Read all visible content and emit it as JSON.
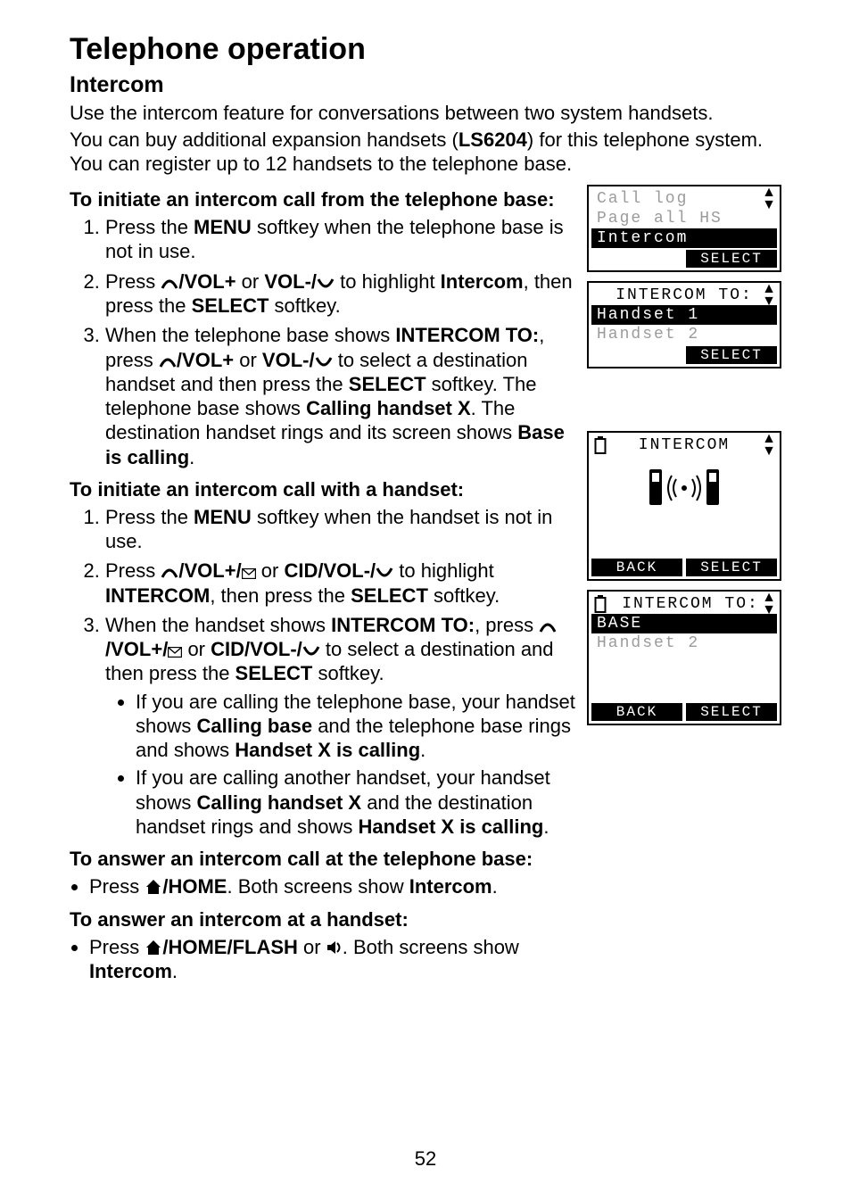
{
  "headings": {
    "h1": "Telephone operation",
    "h2": "Intercom"
  },
  "intro": {
    "p1": "Use the intercom feature for conversations between two system handsets.",
    "p2a": "You can buy additional expansion handsets (",
    "p2_model": "LS6204",
    "p2b": ") for this telephone system. You can register up to 12 handsets to the telephone base."
  },
  "subheadings": {
    "from_base": "To initiate an intercom call from the telephone base:",
    "with_handset": "To initiate an intercom call with a handset:",
    "answer_base": "To answer an intercom call at the telephone base:",
    "answer_handset": "To answer an intercom at a handset:"
  },
  "from_base_steps": {
    "s1a": "Press the ",
    "s1_menu": "MENU",
    "s1b": " softkey when the telephone base is not in use.",
    "s2a": "Press ",
    "s2_vol1a": "/",
    "s2_vol1b": "VOL+",
    "s2_or": " or ",
    "s2_vol2a": "VOL-/",
    "s2b": " to highlight ",
    "s2_intercom": "Intercom",
    "s2c": ", then press the ",
    "s2_select": "SELECT",
    "s2d": " softkey.",
    "s3a": "When the telephone base shows ",
    "s3_intercomto": "INTERCOM TO:",
    "s3b": ", press ",
    "s3c": " to select a destination handset and then press the ",
    "s3_select": "SELECT",
    "s3d": " softkey. The telephone base shows ",
    "s3_calling": "Calling handset X",
    "s3e": ". The destination handset rings and its screen shows ",
    "s3_base": "Base is calling",
    "s3f": "."
  },
  "with_handset_steps": {
    "s1a": "Press the ",
    "s1_menu": "MENU",
    "s1b": " softkey when the handset is not in use.",
    "s2a": "Press ",
    "s2_cid": "CID/VOL-/",
    "s2b": " to highlight ",
    "s2_intercom": "INTERCOM",
    "s2c": ", then press the ",
    "s2_select": "SELECT",
    "s2d": " softkey.",
    "s3a": "When the handset shows ",
    "s3_intercomto": "INTERCOM TO:",
    "s3b": ", press ",
    "s3c": " to select a destination and then press the ",
    "s3_select": "SELECT",
    "s3d": " softkey.",
    "b1a": "If you are calling the telephone base, your handset shows ",
    "b1_cb": "Calling base",
    "b1b": " and the telephone base rings and shows ",
    "b1_hx": "Handset X is calling",
    "b1c": ".",
    "b2a": "If you are calling another handset, your handset shows ",
    "b2_ch": "Calling handset X",
    "b2b": " and the destination handset rings and shows ",
    "b2_hx": "Handset X is calling",
    "b2c": "."
  },
  "answer_base": {
    "a": "Press ",
    "home": "/HOME",
    "b": ". Both screens show ",
    "intercom": "Intercom",
    "c": "."
  },
  "answer_handset": {
    "a": "Press ",
    "home": "/HOME/FLASH",
    "or": " or ",
    "b": ". Both screens show ",
    "intercom": "Intercom",
    "c": "."
  },
  "lcd1": {
    "l1": "Call log",
    "l2": "Page all HS",
    "l3": "Intercom",
    "sk_right": "SELECT"
  },
  "lcd2": {
    "title": "INTERCOM TO:",
    "l1": "Handset 1",
    "l2": "Handset 2",
    "sk_right": "SELECT"
  },
  "lcd3": {
    "title": "INTERCOM",
    "sk_left": "BACK",
    "sk_right": "SELECT"
  },
  "lcd4": {
    "title": "INTERCOM TO:",
    "l1": "BASE",
    "l2": "Handset 2",
    "sk_left": "BACK",
    "sk_right": "SELECT"
  },
  "page_number": "52"
}
